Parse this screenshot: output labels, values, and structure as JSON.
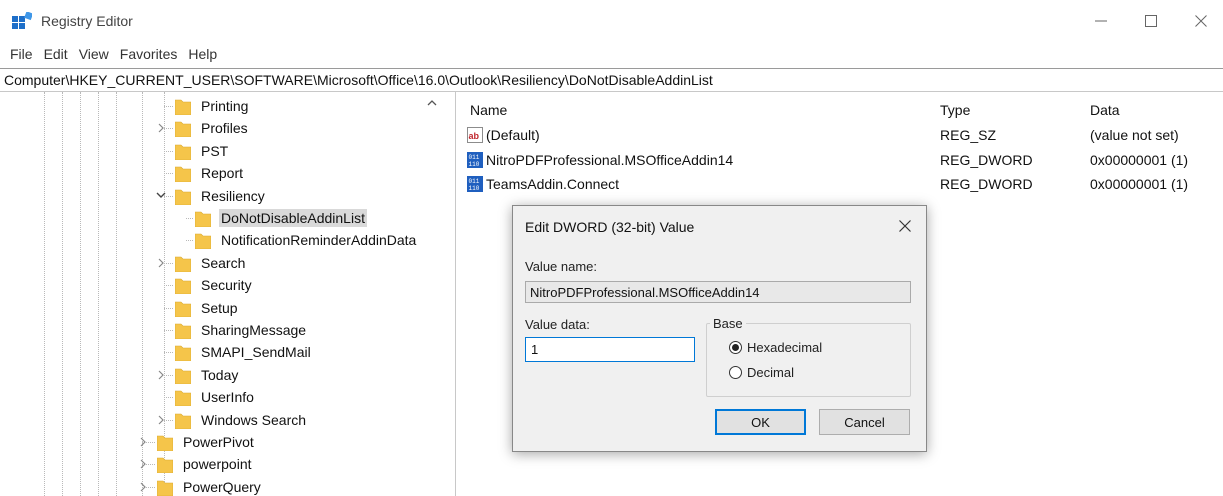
{
  "window": {
    "title": "Registry Editor",
    "controls": {
      "minimize": "—",
      "maximize": "☐",
      "close": "✕"
    }
  },
  "menu": [
    "File",
    "Edit",
    "View",
    "Favorites",
    "Help"
  ],
  "address": "Computer\\HKEY_CURRENT_USER\\SOFTWARE\\Microsoft\\Office\\16.0\\Outlook\\Resiliency\\DoNotDisableAddinList",
  "tree": {
    "level4": [
      {
        "label": "Printing",
        "expander": ""
      },
      {
        "label": "Profiles",
        "expander": "›"
      },
      {
        "label": "PST",
        "expander": ""
      },
      {
        "label": "Report",
        "expander": ""
      },
      {
        "label": "Resiliency",
        "expander": "⌄"
      }
    ],
    "level5": [
      {
        "label": "DoNotDisableAddinList",
        "selected": true
      },
      {
        "label": "NotificationReminderAddinData",
        "selected": false
      }
    ],
    "level4b": [
      {
        "label": "Search",
        "expander": "›"
      },
      {
        "label": "Security",
        "expander": ""
      },
      {
        "label": "Setup",
        "expander": ""
      },
      {
        "label": "SharingMessage",
        "expander": ""
      },
      {
        "label": "SMAPI_SendMail",
        "expander": ""
      },
      {
        "label": "Today",
        "expander": "›"
      },
      {
        "label": "UserInfo",
        "expander": ""
      },
      {
        "label": "Windows Search",
        "expander": "›"
      }
    ],
    "level3": [
      {
        "label": "PowerPivot",
        "expander": "›"
      },
      {
        "label": "powerpoint",
        "expander": "›"
      },
      {
        "label": "PowerQuery",
        "expander": "›"
      }
    ]
  },
  "values": {
    "headers": {
      "name": "Name",
      "type": "Type",
      "data": "Data"
    },
    "rows": [
      {
        "name": "(Default)",
        "icon": "string-value-icon",
        "type": "REG_SZ",
        "data": "(value not set)"
      },
      {
        "name": "NitroPDFProfessional.MSOfficeAddin14",
        "icon": "dword-value-icon",
        "type": "REG_DWORD",
        "data": "0x00000001 (1)"
      },
      {
        "name": "TeamsAddin.Connect",
        "icon": "dword-value-icon",
        "type": "REG_DWORD",
        "data": "0x00000001 (1)"
      }
    ]
  },
  "dialog": {
    "title": "Edit DWORD (32-bit) Value",
    "value_name_label": "Value name:",
    "value_name": "NitroPDFProfessional.MSOfficeAddin14",
    "value_data_label": "Value data:",
    "value_data": "1",
    "base_label": "Base",
    "hex_label": "Hexadecimal",
    "dec_label": "Decimal",
    "base_selected": "Hexadecimal",
    "ok_label": "OK",
    "cancel_label": "Cancel",
    "close": "✕"
  },
  "colors": {
    "folder": "#f5c54a",
    "accent": "#0078d7",
    "dialog_bg": "#f0f0f0"
  }
}
